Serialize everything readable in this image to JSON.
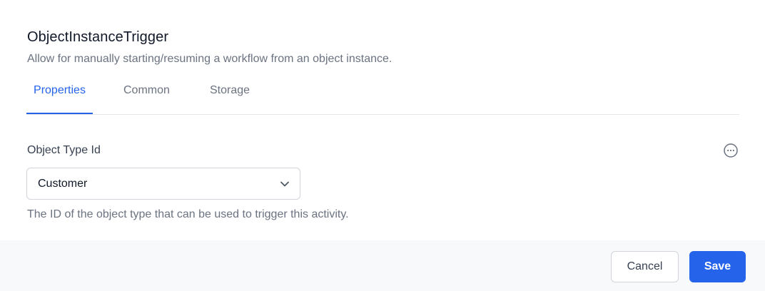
{
  "dialog": {
    "title": "ObjectInstanceTrigger",
    "subtitle": "Allow for manually starting/resuming a workflow from an object instance."
  },
  "tabs": [
    {
      "label": "Properties",
      "active": true
    },
    {
      "label": "Common",
      "active": false
    },
    {
      "label": "Storage",
      "active": false
    }
  ],
  "field": {
    "label": "Object Type Id",
    "selected_value": "Customer",
    "help_text": "The ID of the object type that can be used to trigger this activity.",
    "more_icon": "ellipsis-circle-icon",
    "dropdown_icon": "chevron-down-icon"
  },
  "footer": {
    "cancel_label": "Cancel",
    "save_label": "Save"
  },
  "colors": {
    "accent": "#2563eb",
    "text_primary": "#111827",
    "text_muted": "#6b7280",
    "border": "#d1d5db",
    "footer_bg": "#f8f9fb"
  }
}
